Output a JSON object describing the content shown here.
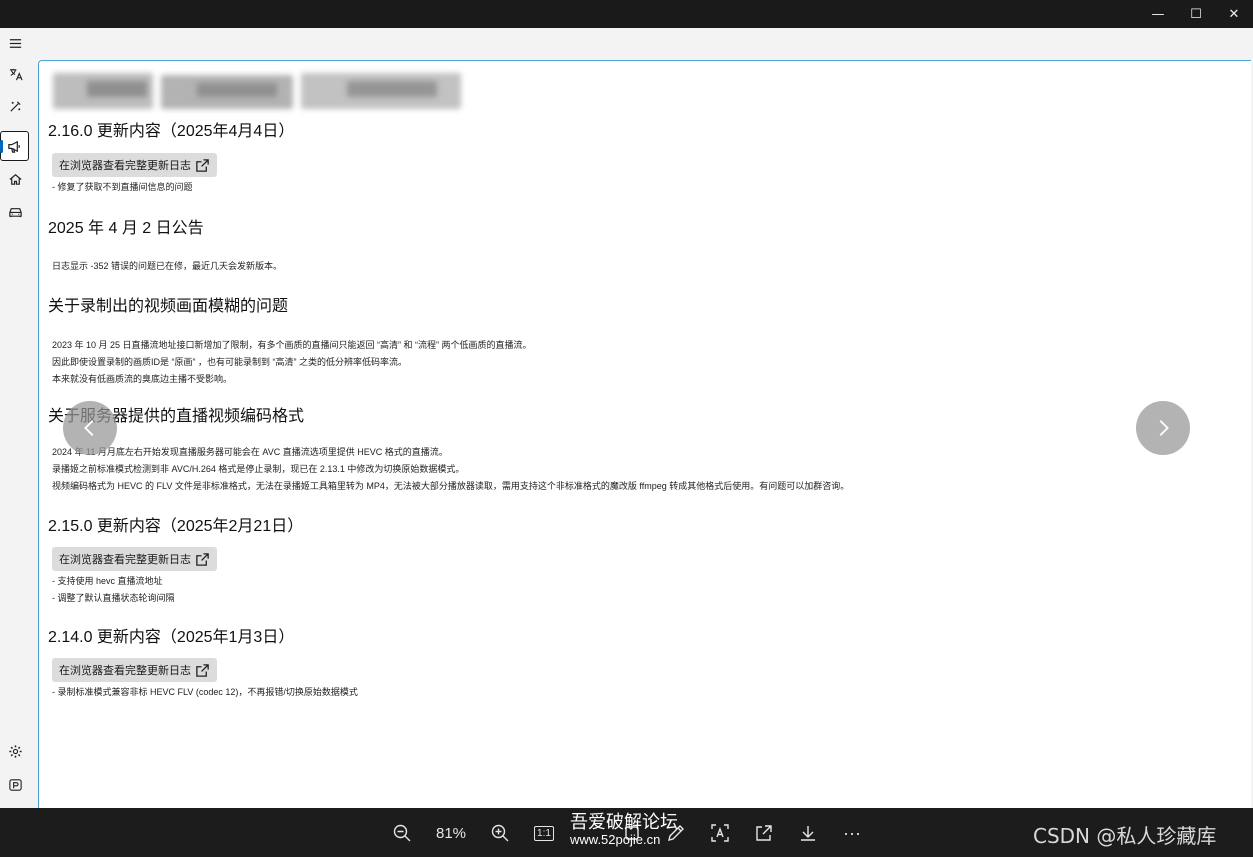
{
  "window": {
    "controls": {
      "minimize": "—",
      "maximize": "☐",
      "close": "✕"
    }
  },
  "navrail": {
    "items": [
      {
        "name": "menu",
        "icon": "hamburger-icon"
      },
      {
        "name": "translate",
        "icon": "translate-icon"
      },
      {
        "name": "magic",
        "icon": "magic-wand-icon"
      },
      {
        "name": "announcements",
        "icon": "megaphone-icon",
        "active": true
      },
      {
        "name": "home",
        "icon": "home-icon"
      },
      {
        "name": "car",
        "icon": "car-icon"
      },
      {
        "name": "settings",
        "icon": "gear-icon"
      },
      {
        "name": "extra",
        "icon": "parking-icon"
      }
    ]
  },
  "content": {
    "sections": [
      {
        "title": "2.16.0 更新内容（2025年4月4日）",
        "button": "在浏览器查看完整更新日志",
        "items": [
          "- 修复了获取不到直播间信息的问题"
        ]
      },
      {
        "title": "2025 年 4 月 2 日公告",
        "items": [
          "日志显示 -352 错误的问题已在修，最近几天会发新版本。"
        ]
      },
      {
        "title": "关于录制出的视频画面模糊的问题",
        "items": [
          "2023 年 10 月 25 日直播流地址接口新增加了限制，有多个画质的直播间只能返回 “高清” 和 “流程” 两个低画质的直播流。",
          "因此即使设置录制的画质ID是 “原画” ，也有可能录制到 “高清” 之类的低分辨率低码率流。",
          "本来就没有低画质流的臭底边主播不受影响。"
        ]
      },
      {
        "title": "关于服务器提供的直播视频编码格式",
        "items": [
          "2024 年 11 月月底左右开始发现直播服务器可能会在 AVC 直播流选项里提供 HEVC 格式的直播流。",
          "录播姬之前标准模式检测到非 AVC/H.264 格式是停止录制，现已在 2.13.1 中修改为切换原始数据模式。",
          "视频编码格式为 HEVC 的 FLV 文件是非标准格式，无法在录播姬工具箱里转为 MP4，无法被大部分播放器读取，需用支持这个非标准格式的魔改版 ffmpeg 转成其他格式后使用。有问题可以加群咨询。"
        ]
      },
      {
        "title": "2.15.0 更新内容（2025年2月21日）",
        "button": "在浏览器查看完整更新日志",
        "items": [
          "- 支持使用 hevc 直播流地址",
          "- 调整了默认直播状态轮询间隔"
        ]
      },
      {
        "title": "2.14.0 更新内容（2025年1月3日）",
        "button": "在浏览器查看完整更新日志",
        "items": [
          "- 录制标准模式兼容非标 HEVC FLV (codec 12)，不再报错/切换原始数据模式"
        ]
      }
    ]
  },
  "toolbar": {
    "zoom": "81%",
    "one_to_one": "1:1",
    "more": "···"
  },
  "watermarks": {
    "left_line1": "吾爱破解论坛",
    "left_line2": "www.52pojie.cn",
    "right": "CSDN @私人珍藏库"
  },
  "colors": {
    "accent": "#0067c0",
    "toolbar_bg": "#1c1c1c",
    "button_bg": "#dcdcdc"
  }
}
